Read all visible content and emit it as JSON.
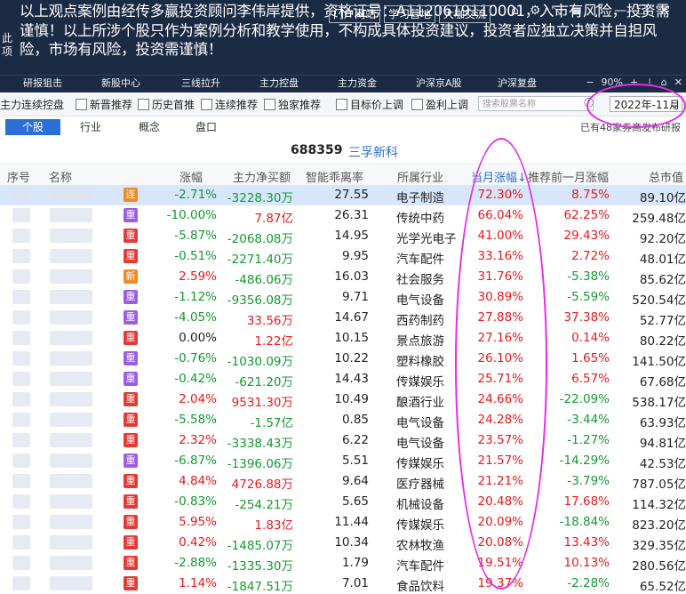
{
  "banner": {
    "text": "以上观点案例由经传多赢投资顾问李伟岸提供，资格证号：A1120619110001，入市有风险，投资需谨慎！以上所涉个股只作为案例分析和教学使用，不构成具体投资建议，投资者应独立决策并自担风险，市场有风险，投资需谨慎！",
    "side_text": "此项",
    "links": [
      "门户网站",
      "学习营地",
      "大咖交流"
    ],
    "icons": [
      "home-icon",
      "gear-icon",
      "shrink-icon",
      "menu-icon",
      "chevron-up-icon",
      "minimize-icon",
      "restore-icon",
      "close-icon"
    ]
  },
  "nav": {
    "items": [
      "研报狙击",
      "新股中心",
      "三线拉升",
      "主力控盘",
      "主力资金",
      "沪深京A股",
      "沪深复盘"
    ],
    "zoom": "90%"
  },
  "filter": {
    "title": "主力连续控盘",
    "checkboxes": [
      "新晋推荐",
      "历史首推",
      "连续推荐",
      "独家推荐",
      "目标价上调",
      "盈利上调"
    ],
    "search_placeholder": "搜索股票名称",
    "month": "2022年-11月"
  },
  "tabs": {
    "items": [
      "个股",
      "行业",
      "概念",
      "盘口"
    ],
    "note": "已有48家券商发布研报"
  },
  "stock": {
    "code": "688359",
    "name": "三孚新科"
  },
  "columns": [
    "序号",
    "名称",
    "涨幅",
    "主力净买额",
    "智能乖离率",
    "所属行业",
    "当月涨幅↓",
    "推荐前一月涨幅",
    "总市值"
  ],
  "colors": {
    "up": "#e5191c",
    "down": "#119a2e",
    "accent": "#2b6fd6",
    "annotation": "#e62be6"
  },
  "rows": [
    {
      "tag": "连",
      "tag_color": "#f08a24",
      "change": "-2.71%",
      "net": "-3228.30万",
      "bias": "27.55",
      "industry": "电子制造",
      "month": "72.30%",
      "prev": "8.75%",
      "cap": "89.10亿"
    },
    {
      "tag": "重",
      "tag_color": "#9b5de5",
      "change": "-10.00%",
      "net": "7.87亿",
      "bias": "26.31",
      "industry": "传统中药",
      "month": "66.04%",
      "prev": "62.25%",
      "cap": "259.48亿"
    },
    {
      "tag": "重",
      "tag_color": "#e53935",
      "change": "-5.87%",
      "net": "-2068.08万",
      "bias": "14.95",
      "industry": "光学光电子",
      "month": "41.00%",
      "prev": "29.43%",
      "cap": "92.20亿"
    },
    {
      "tag": "重",
      "tag_color": "#e53935",
      "change": "-0.51%",
      "net": "-2271.40万",
      "bias": "9.95",
      "industry": "汽车配件",
      "month": "33.16%",
      "prev": "2.72%",
      "cap": "48.01亿"
    },
    {
      "tag": "新",
      "tag_color": "#f08a24",
      "change": "2.59%",
      "net": "-486.06万",
      "bias": "16.03",
      "industry": "社会服务",
      "month": "31.76%",
      "prev": "-5.38%",
      "cap": "85.62亿"
    },
    {
      "tag": "重",
      "tag_color": "#9b5de5",
      "change": "-1.12%",
      "net": "-9356.08万",
      "bias": "9.71",
      "industry": "电气设备",
      "month": "30.89%",
      "prev": "-5.59%",
      "cap": "520.54亿"
    },
    {
      "tag": "重",
      "tag_color": "#9b5de5",
      "change": "-4.05%",
      "net": "33.56万",
      "bias": "14.67",
      "industry": "西药制药",
      "month": "27.88%",
      "prev": "37.38%",
      "cap": "52.77亿"
    },
    {
      "tag": "重",
      "tag_color": "#e53935",
      "change": "0.00%",
      "net": "1.22亿",
      "bias": "10.15",
      "industry": "景点旅游",
      "month": "27.16%",
      "prev": "0.14%",
      "cap": "80.22亿"
    },
    {
      "tag": "重",
      "tag_color": "#9b5de5",
      "change": "-0.76%",
      "net": "-1030.09万",
      "bias": "10.22",
      "industry": "塑料橡胶",
      "month": "26.10%",
      "prev": "1.65%",
      "cap": "141.50亿"
    },
    {
      "tag": "重",
      "tag_color": "#9b5de5",
      "change": "-0.42%",
      "net": "-621.20万",
      "bias": "14.43",
      "industry": "传媒娱乐",
      "month": "25.71%",
      "prev": "6.57%",
      "cap": "67.68亿"
    },
    {
      "tag": "重",
      "tag_color": "#e53935",
      "change": "2.04%",
      "net": "9531.30万",
      "bias": "10.49",
      "industry": "酿酒行业",
      "month": "24.66%",
      "prev": "-22.09%",
      "cap": "538.17亿"
    },
    {
      "tag": "重",
      "tag_color": "#e53935",
      "change": "-5.58%",
      "net": "-1.57亿",
      "bias": "0.85",
      "industry": "电气设备",
      "month": "24.28%",
      "prev": "-3.44%",
      "cap": "63.93亿"
    },
    {
      "tag": "重",
      "tag_color": "#e53935",
      "change": "2.32%",
      "net": "-3338.43万",
      "bias": "6.22",
      "industry": "电气设备",
      "month": "23.57%",
      "prev": "-1.27%",
      "cap": "94.81亿"
    },
    {
      "tag": "重",
      "tag_color": "#9b5de5",
      "change": "-6.87%",
      "net": "-1396.06万",
      "bias": "5.51",
      "industry": "传媒娱乐",
      "month": "21.57%",
      "prev": "-14.29%",
      "cap": "42.53亿"
    },
    {
      "tag": "重",
      "tag_color": "#e53935",
      "change": "4.84%",
      "net": "4726.88万",
      "bias": "9.64",
      "industry": "医疗器械",
      "month": "21.21%",
      "prev": "-3.79%",
      "cap": "787.05亿"
    },
    {
      "tag": "重",
      "tag_color": "#e53935",
      "change": "-0.83%",
      "net": "-254.21万",
      "bias": "5.65",
      "industry": "机械设备",
      "month": "20.48%",
      "prev": "17.68%",
      "cap": "114.32亿"
    },
    {
      "tag": "重",
      "tag_color": "#e53935",
      "change": "5.95%",
      "net": "1.83亿",
      "bias": "11.44",
      "industry": "传媒娱乐",
      "month": "20.09%",
      "prev": "-18.84%",
      "cap": "823.20亿"
    },
    {
      "tag": "重",
      "tag_color": "#e53935",
      "change": "0.42%",
      "net": "-1485.07万",
      "bias": "10.34",
      "industry": "农林牧渔",
      "month": "20.08%",
      "prev": "13.43%",
      "cap": "329.35亿"
    },
    {
      "tag": "重",
      "tag_color": "#e53935",
      "change": "-2.88%",
      "net": "-1335.30万",
      "bias": "1.79",
      "industry": "汽车配件",
      "month": "19.51%",
      "prev": "10.13%",
      "cap": "280.56亿"
    },
    {
      "tag": "重",
      "tag_color": "#e53935",
      "change": "1.14%",
      "net": "-1847.51万",
      "bias": "7.01",
      "industry": "食品饮料",
      "month": "19.37%",
      "prev": "-2.28%",
      "cap": "65.52亿"
    }
  ]
}
